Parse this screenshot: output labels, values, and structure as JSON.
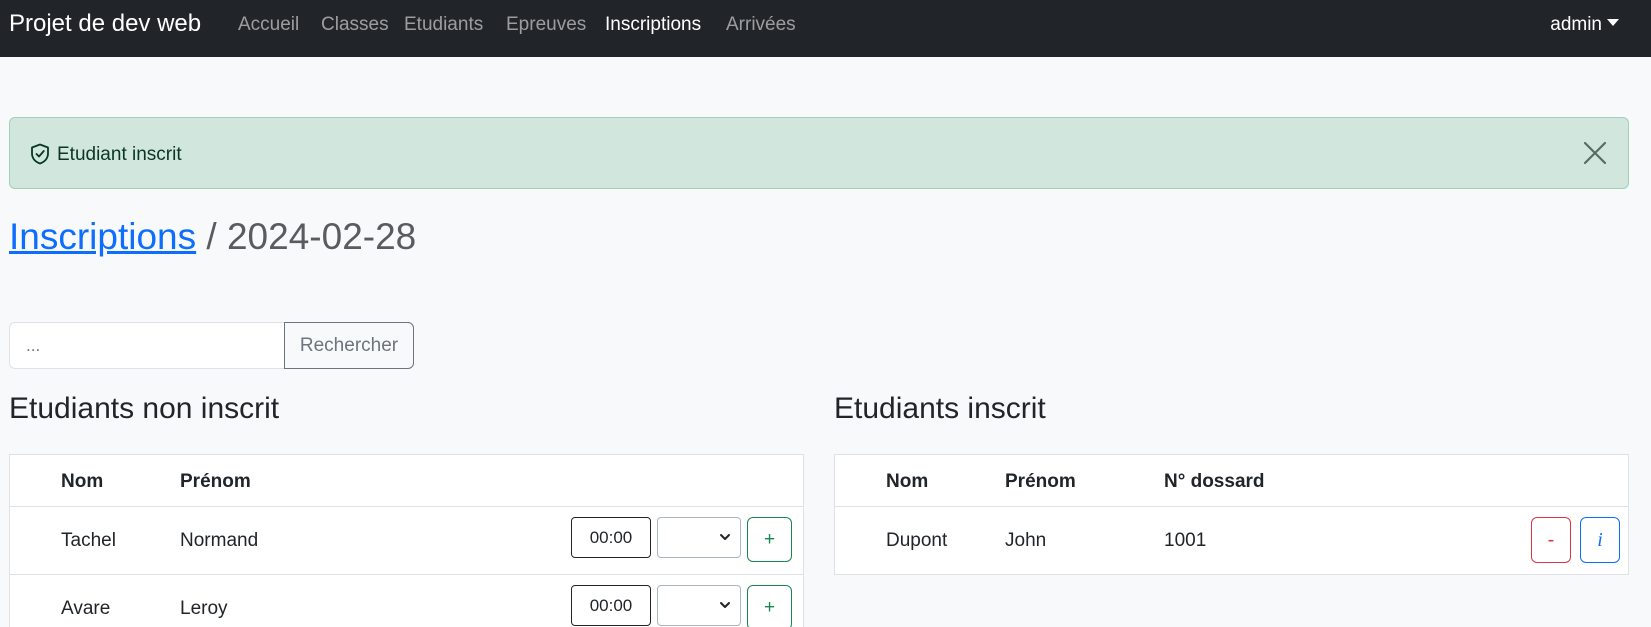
{
  "navbar": {
    "brand": "Projet de dev web",
    "links": [
      "Accueil",
      "Classes",
      "Etudiants",
      "Epreuves",
      "Inscriptions",
      "Arrivées"
    ],
    "active_link": "Inscriptions",
    "user": "admin"
  },
  "alert": {
    "icon": "shield-check-icon",
    "message": "Etudiant inscrit",
    "color": "#d1e7dd"
  },
  "page": {
    "breadcrumb_link": "Inscriptions",
    "separator": "/",
    "date": "2024-02-28"
  },
  "search": {
    "placeholder": "...",
    "button_label": "Rechercher"
  },
  "non_inscrits": {
    "title": "Etudiants non inscrit",
    "columns": [
      "Nom",
      "Prénom"
    ],
    "rows": [
      {
        "nom": "Tachel",
        "prenom": "Normand",
        "time": "00:00",
        "add_label": "+"
      },
      {
        "nom": "Avare",
        "prenom": "Leroy",
        "time": "00:00",
        "add_label": "+"
      }
    ]
  },
  "inscrits": {
    "title": "Etudiants inscrit",
    "columns": [
      "Nom",
      "Prénom",
      "N° dossard"
    ],
    "rows": [
      {
        "nom": "Dupont",
        "prenom": "John",
        "dossard": "1001",
        "remove_label": "-",
        "info_label": "i"
      }
    ]
  },
  "colors": {
    "navbar": "#212529",
    "link": "#0d6efd",
    "success": "#198754",
    "danger": "#dc3545"
  }
}
